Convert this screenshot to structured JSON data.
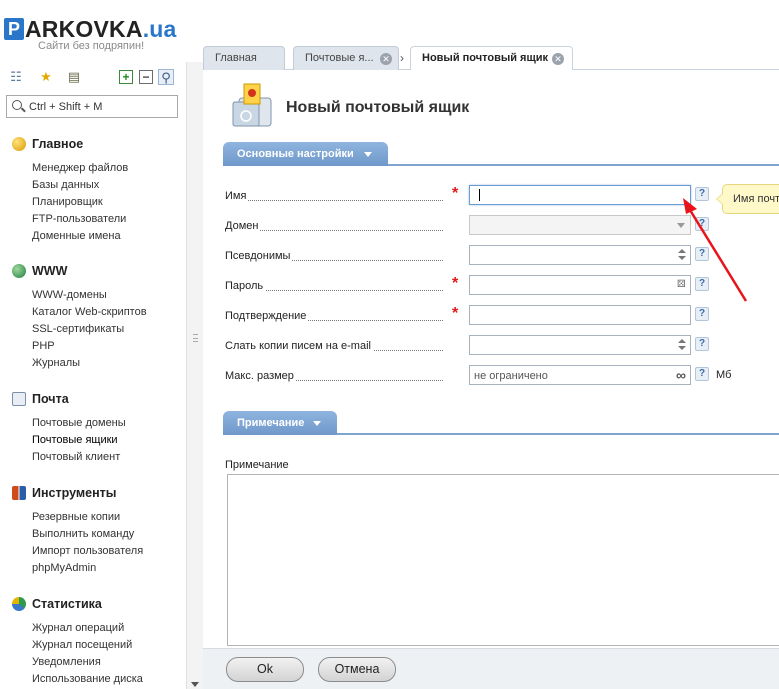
{
  "logo": {
    "letter": "P",
    "name": "ARKOVKA",
    "tld": ".ua",
    "slogan": "Сайти без подряпин!"
  },
  "sidebar": {
    "search_placeholder": "Ctrl + Shift + M",
    "groups": [
      {
        "title": "Главное",
        "items": [
          "Менеджер файлов",
          "Базы данных",
          "Планировщик",
          "FTP-пользователи",
          "Доменные имена"
        ]
      },
      {
        "title": "WWW",
        "items": [
          "WWW-домены",
          "Каталог Web-скриптов",
          "SSL-сертификаты",
          "PHP",
          "Журналы"
        ]
      },
      {
        "title": "Почта",
        "items": [
          "Почтовые домены",
          "Почтовые ящики",
          "Почтовый клиент"
        ]
      },
      {
        "title": "Инструменты",
        "items": [
          "Резервные копии",
          "Выполнить команду",
          "Импорт пользователя",
          "phpMyAdmin"
        ]
      },
      {
        "title": "Статистика",
        "items": [
          "Журнал операций",
          "Журнал посещений",
          "Уведомления",
          "Использование диска"
        ]
      }
    ]
  },
  "tabs": [
    {
      "label": "Главная"
    },
    {
      "label": "Почтовые я..."
    },
    {
      "label": "Новый почтовый ящик"
    }
  ],
  "page": {
    "title": "Новый почтовый ящик",
    "section_main": "Основные настройки",
    "section_note": "Примечание",
    "fields": {
      "name": {
        "label": "Имя",
        "value": ""
      },
      "domain": {
        "label": "Домен",
        "value": ""
      },
      "aliases": {
        "label": "Псевдонимы",
        "value": ""
      },
      "password": {
        "label": "Пароль",
        "value": ""
      },
      "confirm": {
        "label": "Подтверждение",
        "value": ""
      },
      "copies": {
        "label": "Слать копии писем на e-mail",
        "value": ""
      },
      "max_size": {
        "label": "Макс. размер",
        "placeholder": "не ограничено",
        "unit": "Мб"
      }
    },
    "help_mark": "?",
    "required_mark": "*",
    "tooltip": "Имя почт",
    "note_label": "Примечание",
    "ok_label": "Ok",
    "cancel_label": "Отмена"
  },
  "colors": {
    "accent": "#6f98c9",
    "required": "#e01818",
    "annotation_arrow": "#e8141b",
    "tooltip_bg": "#fff9c9"
  }
}
